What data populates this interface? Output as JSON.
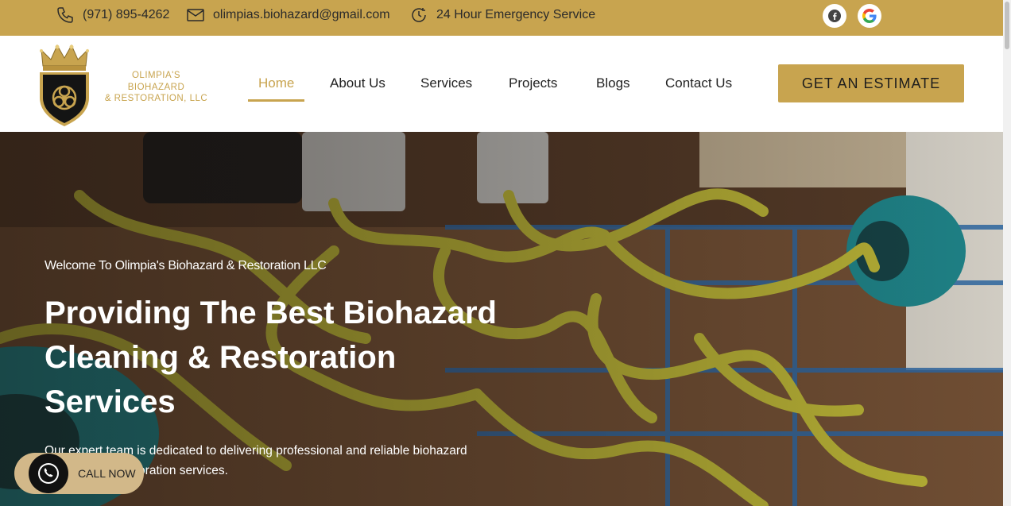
{
  "topbar": {
    "phone": "(971) 895-4262",
    "email": "olimpias.biohazard@gmail.com",
    "service": "24 Hour Emergency Service",
    "icons": [
      "phone-icon",
      "mail-icon",
      "clock-service-icon",
      "facebook-icon",
      "google-icon"
    ]
  },
  "logo": {
    "line1": "OLIMPIA'S",
    "line2": "BIOHAZARD",
    "line3": "& RESTORATION, LLC"
  },
  "nav": {
    "items": [
      {
        "label": "Home",
        "active": true
      },
      {
        "label": "About Us"
      },
      {
        "label": "Services"
      },
      {
        "label": "Projects"
      },
      {
        "label": "Blogs"
      },
      {
        "label": "Contact Us"
      }
    ]
  },
  "cta": {
    "estimate": "GET AN ESTIMATE"
  },
  "hero": {
    "welcome": "Welcome To Olimpia's Biohazard & Restoration LLC",
    "headline_1": "Providing The Best Biohazard",
    "headline_2": "Cleaning & Restoration",
    "headline_3": "Services",
    "description": "Our expert team is dedicated to delivering professional and reliable biohazard cleaning and restoration services."
  },
  "call_now": {
    "label": "CALL NOW"
  },
  "colors": {
    "brand_gold": "#c8a44f",
    "text_dark": "#222222"
  }
}
